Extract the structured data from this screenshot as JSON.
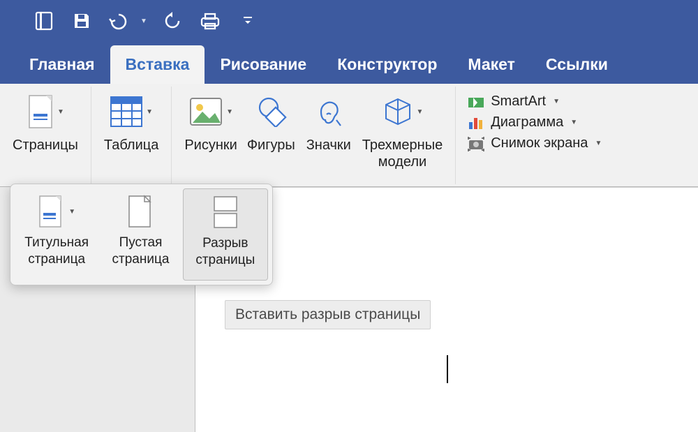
{
  "tabs": {
    "home": "Главная",
    "insert": "Вставка",
    "draw": "Рисование",
    "design": "Конструктор",
    "layout": "Макет",
    "references": "Ссылки"
  },
  "ribbon": {
    "pages": "Страницы",
    "table": "Таблица",
    "pictures": "Рисунки",
    "shapes": "Фигуры",
    "icons": "Значки",
    "models3d_line1": "Трехмерные",
    "models3d_line2": "модели",
    "smartart": "SmartArt",
    "chart": "Диаграмма",
    "screenshot": "Снимок экрана"
  },
  "pages_popup": {
    "cover_line1": "Титульная",
    "cover_line2": "страница",
    "blank_line1": "Пустая",
    "blank_line2": "страница",
    "break_line1": "Разрыв",
    "break_line2": "страницы"
  },
  "tooltip": "Вставить разрыв страницы"
}
